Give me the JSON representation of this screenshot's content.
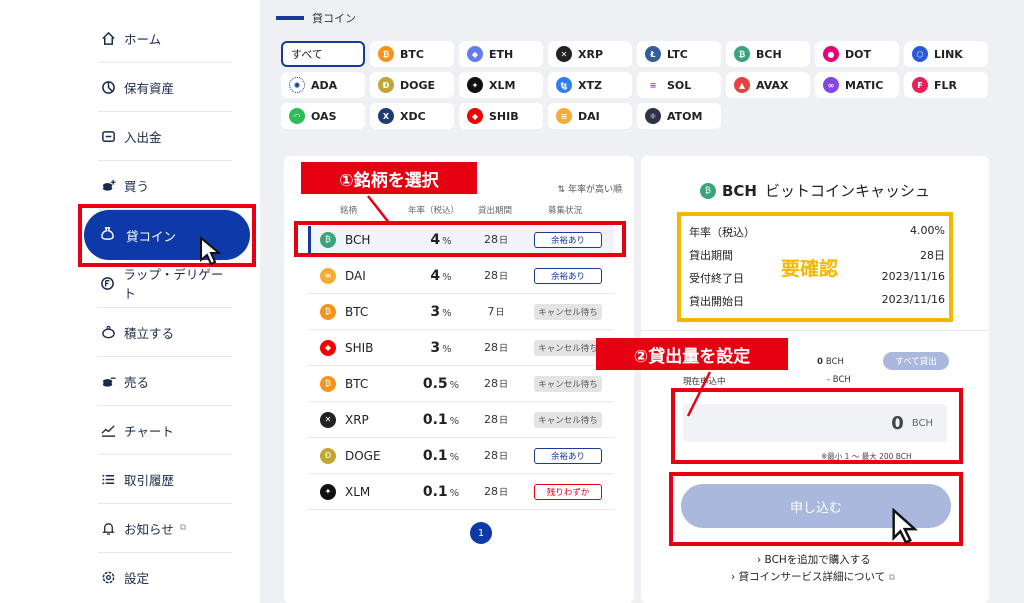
{
  "sidebar": {
    "items": [
      {
        "label": "ホーム",
        "icon": "home-icon"
      },
      {
        "label": "保有資産",
        "icon": "pie-chart-icon"
      },
      {
        "label": "入出金",
        "icon": "transfer-icon"
      },
      {
        "label": "買う",
        "icon": "coin-buy-icon"
      },
      {
        "label": "貸コイン",
        "icon": "money-bag-icon"
      },
      {
        "label": "ラップ・デリゲート",
        "icon": "coin-circle-icon"
      },
      {
        "label": "積立する",
        "icon": "piggy-bank-icon"
      },
      {
        "label": "売る",
        "icon": "coin-sell-icon"
      },
      {
        "label": "チャート",
        "icon": "chart-line-icon"
      },
      {
        "label": "取引履歴",
        "icon": "list-icon"
      },
      {
        "label": "お知らせ",
        "icon": "bell-icon"
      },
      {
        "label": "設定",
        "icon": "gear-icon"
      }
    ]
  },
  "main": {
    "title": "貸コイン",
    "coins": [
      {
        "label": "すべて",
        "color": ""
      },
      {
        "label": "BTC",
        "color": "#f7931a"
      },
      {
        "label": "ETH",
        "color": "#627eea"
      },
      {
        "label": "XRP",
        "color": "#222222"
      },
      {
        "label": "LTC",
        "color": "#345d9d"
      },
      {
        "label": "BCH",
        "color": "#3aa57a"
      },
      {
        "label": "DOT",
        "color": "#e6007a"
      },
      {
        "label": "LINK",
        "color": "#2a5ada"
      },
      {
        "label": "ADA",
        "color": "#0033ad"
      },
      {
        "label": "DOGE",
        "color": "#c2a633"
      },
      {
        "label": "XLM",
        "color": "#111111"
      },
      {
        "label": "XTZ",
        "color": "#2c7df7"
      },
      {
        "label": "SOL",
        "color": "#9945ff"
      },
      {
        "label": "AVAX",
        "color": "#e84142"
      },
      {
        "label": "MATIC",
        "color": "#8247e5"
      },
      {
        "label": "FLR",
        "color": "#e62058"
      },
      {
        "label": "OAS",
        "color": "#2ebd59"
      },
      {
        "label": "XDC",
        "color": "#1e3c72"
      },
      {
        "label": "SHIB",
        "color": "#f00500"
      },
      {
        "label": "DAI",
        "color": "#f5ac37"
      },
      {
        "label": "ATOM",
        "color": "#2e3148"
      }
    ]
  },
  "list": {
    "sort_label": "年率が高い順",
    "headers": {
      "name": "銘柄",
      "rate": "年率（税込）",
      "period": "貸出期間",
      "status": "募集状況"
    },
    "rows": [
      {
        "symbol": "BCH",
        "rate": "4",
        "rate_unit": "%",
        "period": "28",
        "period_unit": "日",
        "status": "余裕あり",
        "status_type": "avail",
        "color": "#3aa57a"
      },
      {
        "symbol": "DAI",
        "rate": "4",
        "rate_unit": "%",
        "period": "28",
        "period_unit": "日",
        "status": "余裕あり",
        "status_type": "avail",
        "color": "#f5ac37"
      },
      {
        "symbol": "BTC",
        "rate": "3",
        "rate_unit": "%",
        "period": "7",
        "period_unit": "日",
        "status": "キャンセル待ち",
        "status_type": "cancel",
        "color": "#f7931a"
      },
      {
        "symbol": "SHIB",
        "rate": "3",
        "rate_unit": "%",
        "period": "28",
        "period_unit": "日",
        "status": "キャンセル待ち",
        "status_type": "cancel",
        "color": "#f00500"
      },
      {
        "symbol": "BTC",
        "rate": "0.5",
        "rate_unit": "%",
        "period": "28",
        "period_unit": "日",
        "status": "キャンセル待ち",
        "status_type": "cancel",
        "color": "#f7931a"
      },
      {
        "symbol": "XRP",
        "rate": "0.1",
        "rate_unit": "%",
        "period": "28",
        "period_unit": "日",
        "status": "キャンセル待ち",
        "status_type": "cancel",
        "color": "#222222"
      },
      {
        "symbol": "DOGE",
        "rate": "0.1",
        "rate_unit": "%",
        "period": "28",
        "period_unit": "日",
        "status": "余裕あり",
        "status_type": "avail",
        "color": "#c2a633"
      },
      {
        "symbol": "XLM",
        "rate": "0.1",
        "rate_unit": "%",
        "period": "28",
        "period_unit": "日",
        "status": "残りわずか",
        "status_type": "few",
        "color": "#111111"
      }
    ],
    "page": "1"
  },
  "annotations": {
    "step1": "①銘柄を選択",
    "step2": "②貸出量を設定",
    "confirm": "要確認"
  },
  "detail": {
    "symbol": "BCH",
    "name": "ビットコインキャッシュ",
    "info": [
      {
        "label": "年率（税込）",
        "value": "4.00%"
      },
      {
        "label": "貸出期間",
        "value": "28日"
      },
      {
        "label": "受付終了日",
        "value": "2023/11/16"
      },
      {
        "label": "貸出開始日",
        "value": "2023/11/16"
      }
    ],
    "available_value": "0",
    "available_unit": "BCH",
    "all_button": "すべて貸出",
    "pending_label": "現在申込中",
    "pending_value": "-",
    "pending_unit": "BCH",
    "amount_value": "0",
    "amount_unit": "BCH",
    "range_note": "※最小 1 ～ 最大 200  BCH",
    "submit": "申し込む",
    "link_buy": "BCHを追加で購入する",
    "link_detail": "貸コインサービス詳細について"
  }
}
